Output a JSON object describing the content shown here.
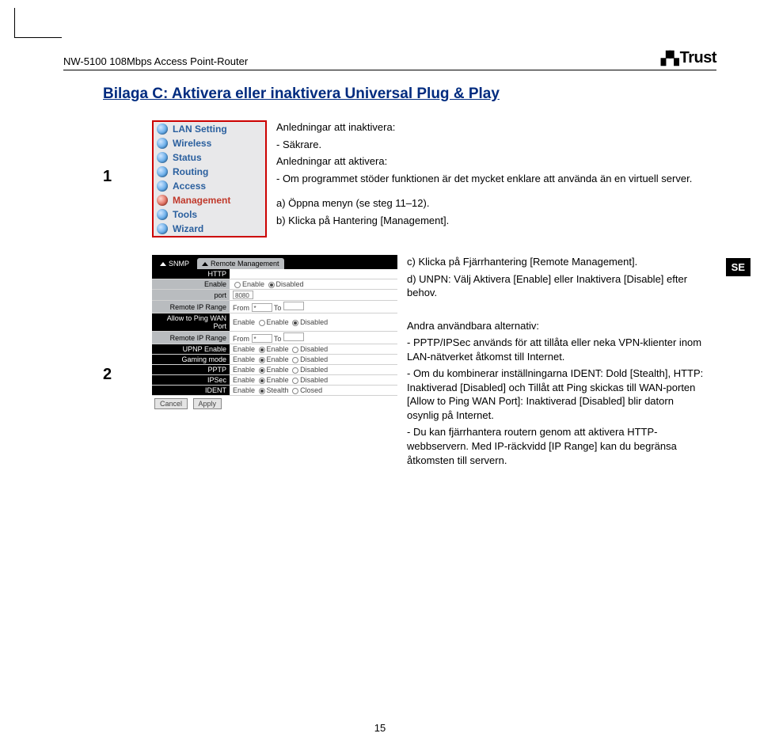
{
  "header": {
    "doc_title": "NW-5100 108Mbps Access Point-Router",
    "brand": "Trust"
  },
  "title": "Bilaga C: Aktivera eller inaktivera Universal Plug & Play",
  "step1": {
    "num": "1",
    "menu": [
      "LAN Setting",
      "Wireless",
      "Status",
      "Routing",
      "Access",
      "Management",
      "Tools",
      "Wizard"
    ],
    "desc": {
      "l1": "Anledningar att inaktivera:",
      "l2": "-   Säkrare.",
      "l3": "Anledningar att aktivera:",
      "l4": "-   Om programmet stöder funktionen är det mycket enklare att använda än en virtuell server.",
      "l5": "a) Öppna menyn (se steg 11–12).",
      "l6": "b) Klicka på Hantering [Management]."
    }
  },
  "step2": {
    "num": "2",
    "panel": {
      "tab1": "SNMP",
      "tab2": "Remote Management",
      "rows": {
        "http": "HTTP",
        "enable_lbl": "Enable",
        "enable_opt1": "Enable",
        "enable_opt2": "Disabled",
        "port_lbl": "port",
        "port_val": "8080",
        "riprange": "Remote IP Range",
        "from": "From",
        "to": "To",
        "star": "*",
        "allowping": "Allow to Ping WAN Port",
        "upnp": "UPNP Enable",
        "gaming": "Gaming mode",
        "pptp": "PPTP",
        "ipsec": "IPSec",
        "ident": "IDENT",
        "stealth": "Stealth",
        "closed": "Closed"
      },
      "btn_cancel": "Cancel",
      "btn_apply": "Apply"
    },
    "desc": {
      "c": "c) Klicka på Fjärrhantering [Remote Management].",
      "d": "d) UNPN: Välj Aktivera [Enable] eller Inaktivera [Disable] efter behov.",
      "alt_h": "Andra användbara alternativ:",
      "alt1": "- PPTP/IPSec används för att tillåta eller neka VPN-klienter inom LAN-nätverket åtkomst till Internet.",
      "alt2": "- Om du kombinerar inställningarna IDENT: Dold [Stealth], HTTP: Inaktiverad [Disabled] och Tillåt att Ping skickas till WAN-porten [Allow to Ping WAN Port]: Inaktiverad [Disabled] blir datorn osynlig på Internet.",
      "alt3": "- Du kan fjärrhantera routern genom att aktivera HTTP-webbservern. Med IP-räckvidd [IP Range] kan du begränsa åtkomsten till servern."
    },
    "se": "SE"
  },
  "pagenum": "15"
}
